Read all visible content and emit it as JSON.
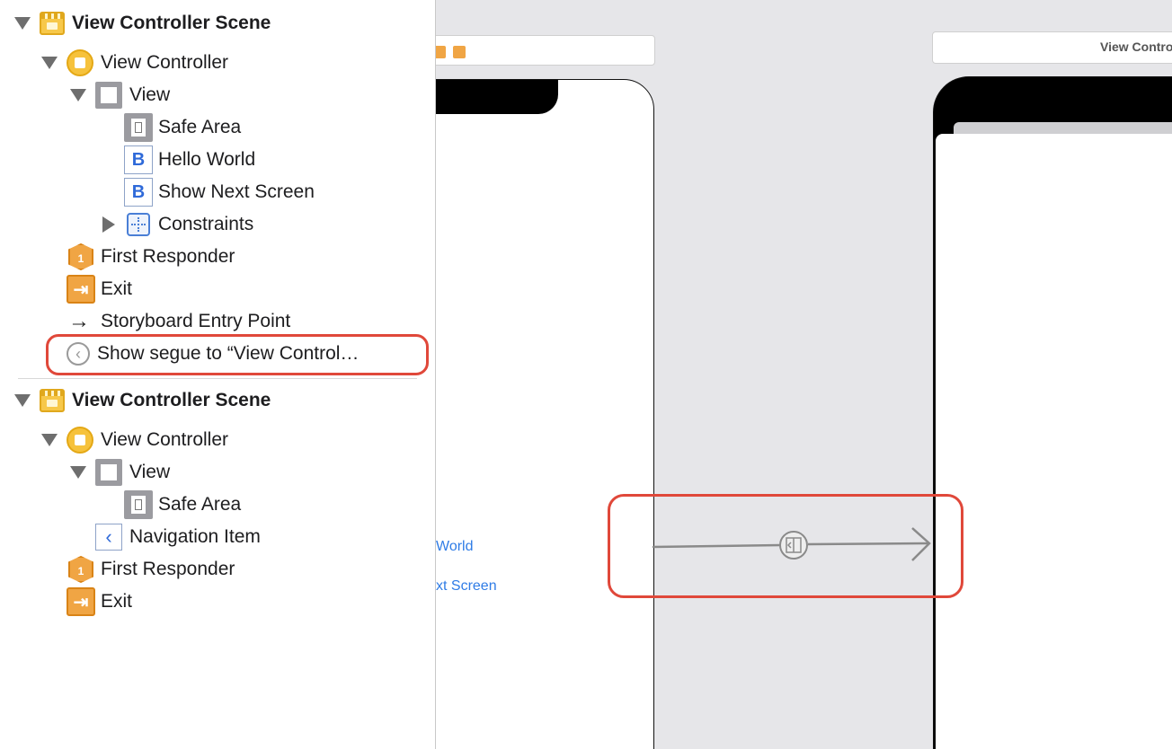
{
  "outline": {
    "scene1": {
      "title": "View Controller Scene",
      "view_controller": "View Controller",
      "view": "View",
      "safe_area": "Safe Area",
      "button1": "Hello World",
      "button2": "Show Next Screen",
      "constraints": "Constraints",
      "first_responder": "First Responder",
      "exit": "Exit",
      "entry_point": "Storyboard Entry Point",
      "segue": "Show segue to “View Control…"
    },
    "scene2": {
      "title": "View Controller Scene",
      "view_controller": "View Controller",
      "view": "View",
      "safe_area": "Safe Area",
      "nav_item": "Navigation Item",
      "first_responder": "First Responder",
      "exit": "Exit"
    },
    "icons": {
      "button_glyph": "B",
      "first_responder_glyph": "1",
      "exit_glyph": "⇥",
      "entry_arrow": "→",
      "segue_glyph": "‹",
      "nav_glyph": "‹"
    }
  },
  "canvas": {
    "second_scene_title": "View Contro",
    "button1_partial": "World",
    "button2_partial": "xt Screen"
  }
}
